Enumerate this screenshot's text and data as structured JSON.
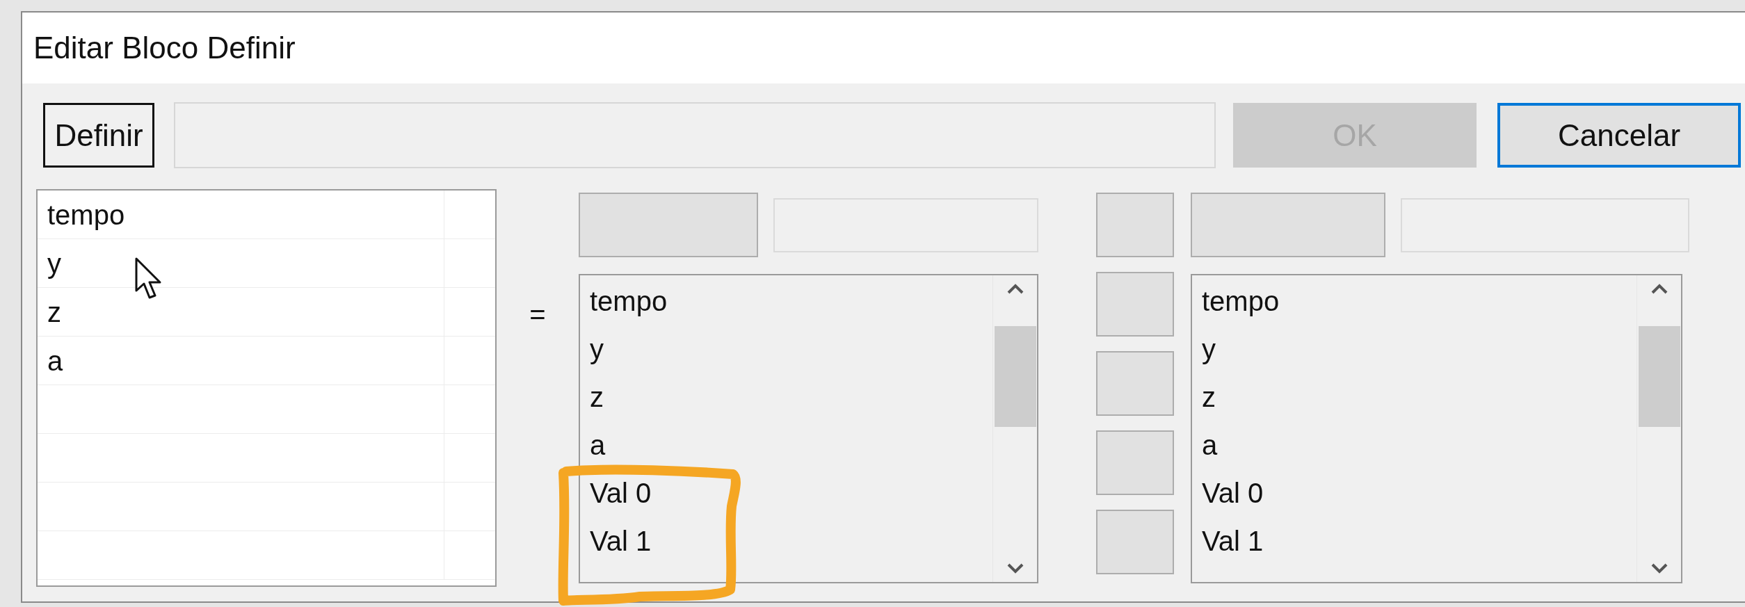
{
  "window": {
    "title": "Editar Bloco Definir"
  },
  "buttons": [
    {
      "label": "Definir",
      "kind": "bordered",
      "disabled": false,
      "focused": false
    },
    {
      "label": "OK",
      "kind": "push",
      "disabled": true,
      "focused": false
    },
    {
      "label": "Cancelar",
      "kind": "push",
      "disabled": false,
      "focused": true
    }
  ],
  "variables": [
    "tempo",
    "y",
    "z",
    "a"
  ],
  "equals": "=",
  "source_list": [
    "tempo",
    "y",
    "z",
    "a",
    "Val 0",
    "Val 1"
  ],
  "target_list": [
    "tempo",
    "y",
    "z",
    "a",
    "Val 0",
    "Val 1"
  ]
}
